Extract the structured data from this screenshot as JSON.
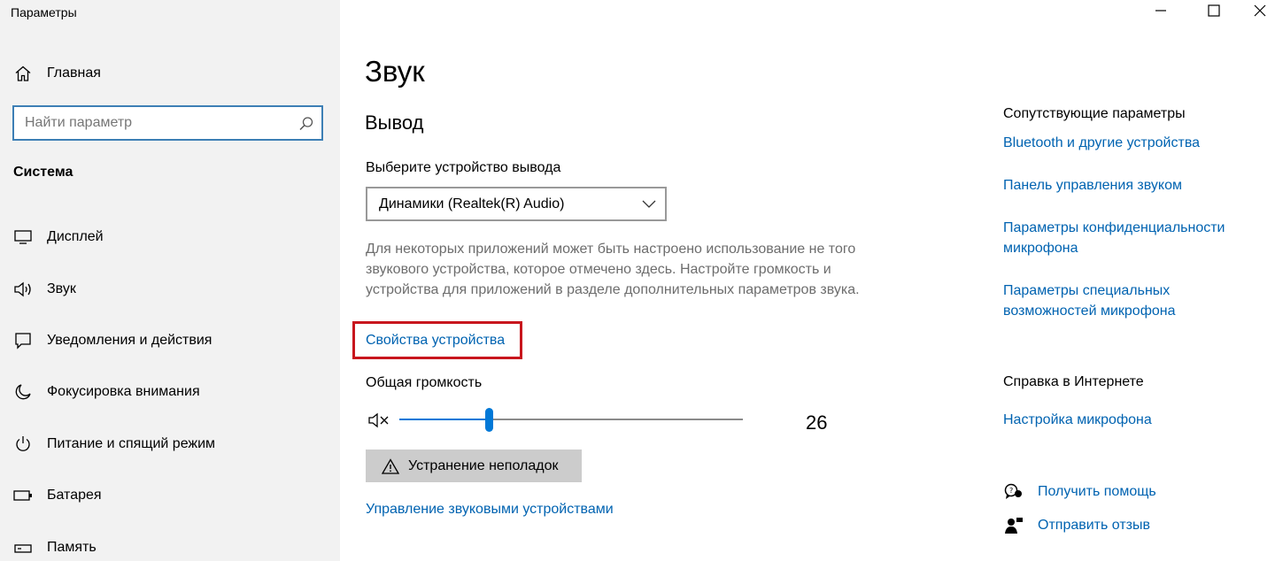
{
  "window": {
    "title": "Параметры",
    "controls": [
      "minimize",
      "maximize",
      "close"
    ]
  },
  "sidebar": {
    "home_label": "Главная",
    "search": {
      "placeholder": "Найти параметр",
      "value": ""
    },
    "section_title": "Система",
    "items": [
      {
        "label": "Дисплей",
        "icon": "monitor-icon"
      },
      {
        "label": "Звук",
        "icon": "speaker-icon"
      },
      {
        "label": "Уведомления и действия",
        "icon": "notification-icon"
      },
      {
        "label": "Фокусировка внимания",
        "icon": "moon-icon"
      },
      {
        "label": "Питание и спящий режим",
        "icon": "power-icon"
      },
      {
        "label": "Батарея",
        "icon": "battery-icon"
      },
      {
        "label": "Память",
        "icon": "storage-icon"
      }
    ]
  },
  "main": {
    "title": "Звук",
    "output_heading": "Вывод",
    "output_device_label": "Выберите устройство вывода",
    "output_device_value": "Динамики (Realtek(R) Audio)",
    "description": "Для некоторых приложений может быть настроено использование не того звукового устройства, которое отмечено здесь. Настройте громкость и устройства для приложений в разделе дополнительных параметров звука.",
    "device_properties_link": "Свойства устройства",
    "volume_label": "Общая громкость",
    "volume_value": "26",
    "volume_level": 26,
    "troubleshoot_label": "Устранение неполадок",
    "manage_devices_link": "Управление звуковыми устройствами"
  },
  "related": {
    "heading": "Сопутствующие параметры",
    "links": [
      "Bluetooth и другие устройства",
      "Панель управления звуком",
      "Параметры конфиденциальности микрофона",
      "Параметры специальных возможностей микрофона"
    ],
    "web_help_heading": "Справка в Интернете",
    "web_help_links": [
      "Настройка микрофона"
    ],
    "get_help": "Получить помощь",
    "feedback": "Отправить отзыв"
  },
  "colors": {
    "accent": "#0078d7",
    "link": "#0063b1",
    "highlight_box": "#c8161d",
    "sidebar_bg": "#f2f2f2"
  }
}
